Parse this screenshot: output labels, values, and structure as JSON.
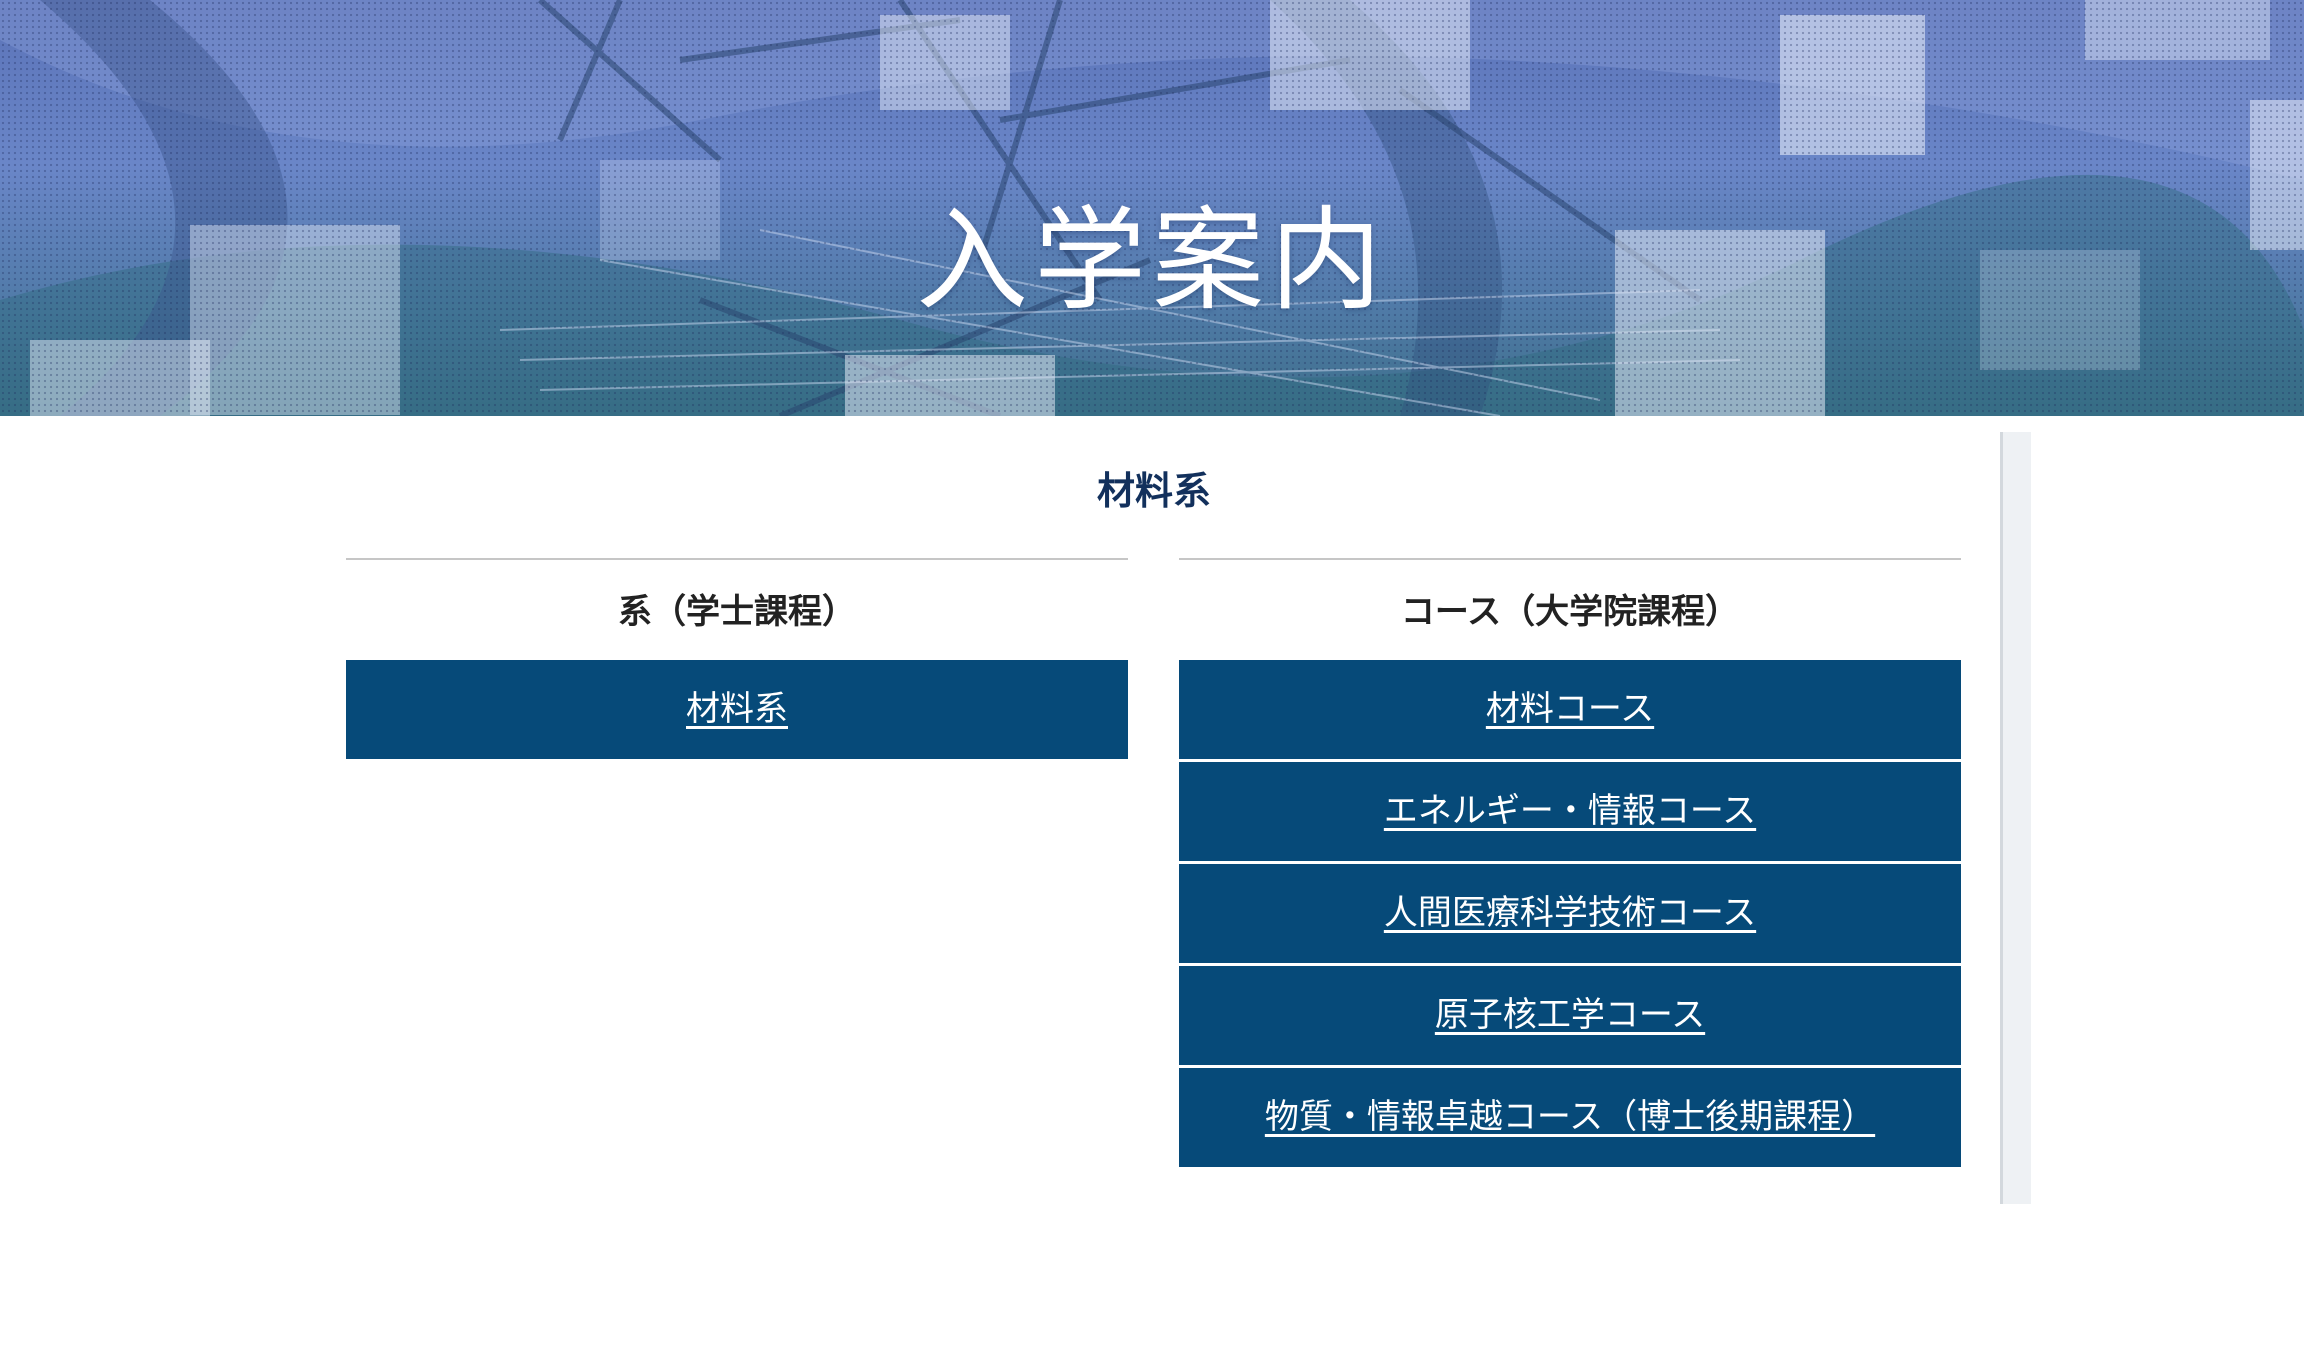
{
  "hero": {
    "title": "入学案内"
  },
  "section": {
    "title": "材料系"
  },
  "undergrad": {
    "heading": "系（学士課程）",
    "links": [
      "材料系"
    ]
  },
  "graduate": {
    "heading": "コース（大学院課程）",
    "links": [
      "材料コース",
      "エネルギー・情報コース",
      "人間医療科学技術コース",
      "原子核工学コース",
      "物質・情報卓越コース（博士後期課程）"
    ]
  },
  "colors": {
    "link_box_bg": "#064a79",
    "section_title": "#12305c",
    "rule": "#c6c6c6"
  }
}
